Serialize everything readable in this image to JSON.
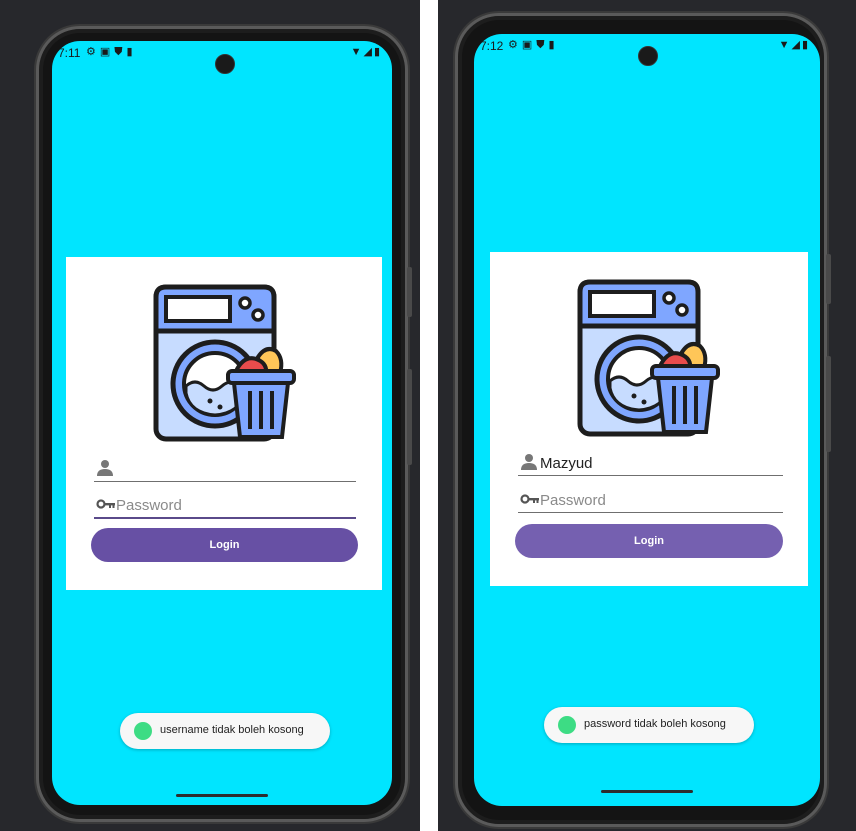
{
  "screens": [
    {
      "status_time": "7:11",
      "status_left_icons": [
        "gear-icon",
        "box-icon",
        "shield-icon",
        "sd-card-icon"
      ],
      "status_right_icons": [
        "wifi-icon",
        "signal-icon",
        "battery-icon"
      ],
      "username": {
        "value": "",
        "placeholder": ""
      },
      "password": {
        "value": "",
        "placeholder": "Password"
      },
      "login_label": "Login",
      "toast_text": "username tidak boleh kosong",
      "focused_field": "password"
    },
    {
      "status_time": "7:12",
      "status_left_icons": [
        "gear-icon",
        "box-icon",
        "shield-icon",
        "sd-card-icon"
      ],
      "status_right_icons": [
        "wifi-icon",
        "signal-icon",
        "battery-icon"
      ],
      "username": {
        "value": "Mazyud",
        "placeholder": ""
      },
      "password": {
        "value": "",
        "placeholder": "Password"
      },
      "login_label": "Login",
      "toast_text": "password tidak boleh kosong",
      "focused_field": "none"
    }
  ],
  "colors": {
    "screen_background": "#00e5ff",
    "card_background": "#ffffff",
    "login_button": "#6750a4",
    "toast_icon": "#3ddc84",
    "phone_frame": "#141414"
  }
}
